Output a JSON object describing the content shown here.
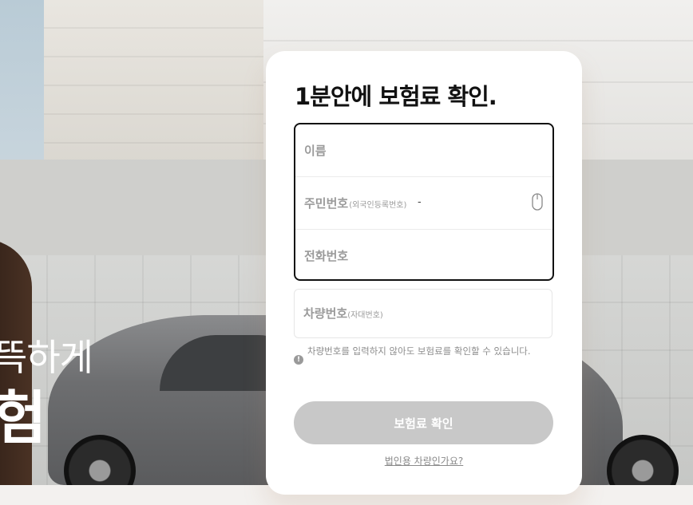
{
  "hero": {
    "line1": "뜩하게",
    "line2": "험"
  },
  "form": {
    "title": "1분안에 보험료 확인.",
    "name_label": "이름",
    "ssn_label": "주민번호",
    "ssn_sub": "(외국인등록번호)",
    "ssn_separator": "-",
    "phone_label": "전화번호",
    "car_label": "차량번호",
    "car_sub": "(자대번호)",
    "notice": "차량번호를 입력하지 않아도 보험료를 확인할 수 있습니다.",
    "submit_label": "보험료 확인",
    "corp_link": "법인용 차량인가요?"
  },
  "icons": {
    "secure_keyboard": "mouse-icon",
    "notice": "info-icon"
  },
  "colors": {
    "submit_disabled": "#c8c8c8",
    "active_border": "#111111"
  }
}
